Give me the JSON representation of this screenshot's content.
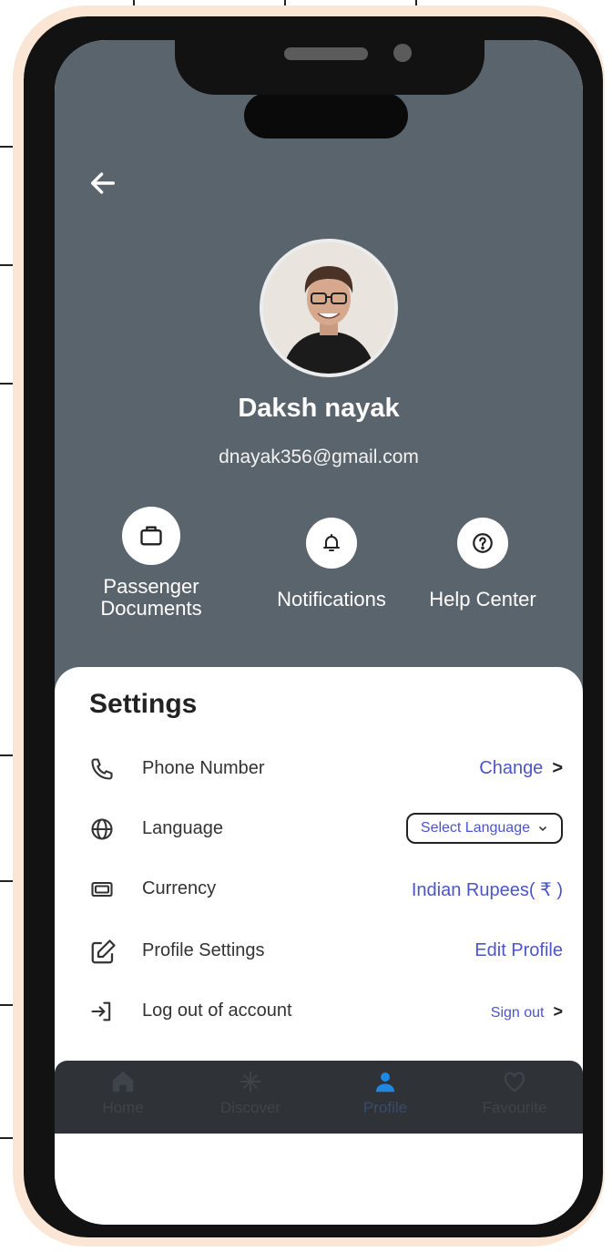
{
  "profile": {
    "name": "Daksh nayak",
    "email": "dnayak356@gmail.com"
  },
  "quick_actions": [
    {
      "label_line1": "Passenger",
      "label_line2": "Documents",
      "icon": "briefcase-icon"
    },
    {
      "label_line1": "Notifications",
      "icon": "bell-icon"
    },
    {
      "label_line1": "Help Center",
      "icon": "question-icon"
    }
  ],
  "settings": {
    "title": "Settings",
    "rows": [
      {
        "label": "Phone Number",
        "action": "Change",
        "icon": "phone-icon"
      },
      {
        "label": "Language",
        "action": "Select Language",
        "icon": "globe-icon"
      },
      {
        "label": "Currency",
        "action": "Indian Rupees( ₹ )",
        "icon": "currency-icon"
      },
      {
        "label": "Profile Settings",
        "action": "Edit Profile",
        "icon": "edit-icon"
      },
      {
        "label": "Log out of account",
        "action": "Sign out",
        "icon": "logout-icon"
      }
    ]
  },
  "nav": {
    "items": [
      {
        "label": "Home",
        "icon": "home-icon"
      },
      {
        "label": "Discover",
        "icon": "sparkle-icon"
      },
      {
        "label": "Profile",
        "icon": "user-icon"
      },
      {
        "label": "Favourite",
        "icon": "heart-icon"
      }
    ],
    "active": "Profile",
    "active_color": "#1e88e5"
  },
  "colors": {
    "header_bg": "#5a646d",
    "accent": "#4b55c8",
    "frame": "#121212",
    "frame_border": "#fbe6d6"
  }
}
